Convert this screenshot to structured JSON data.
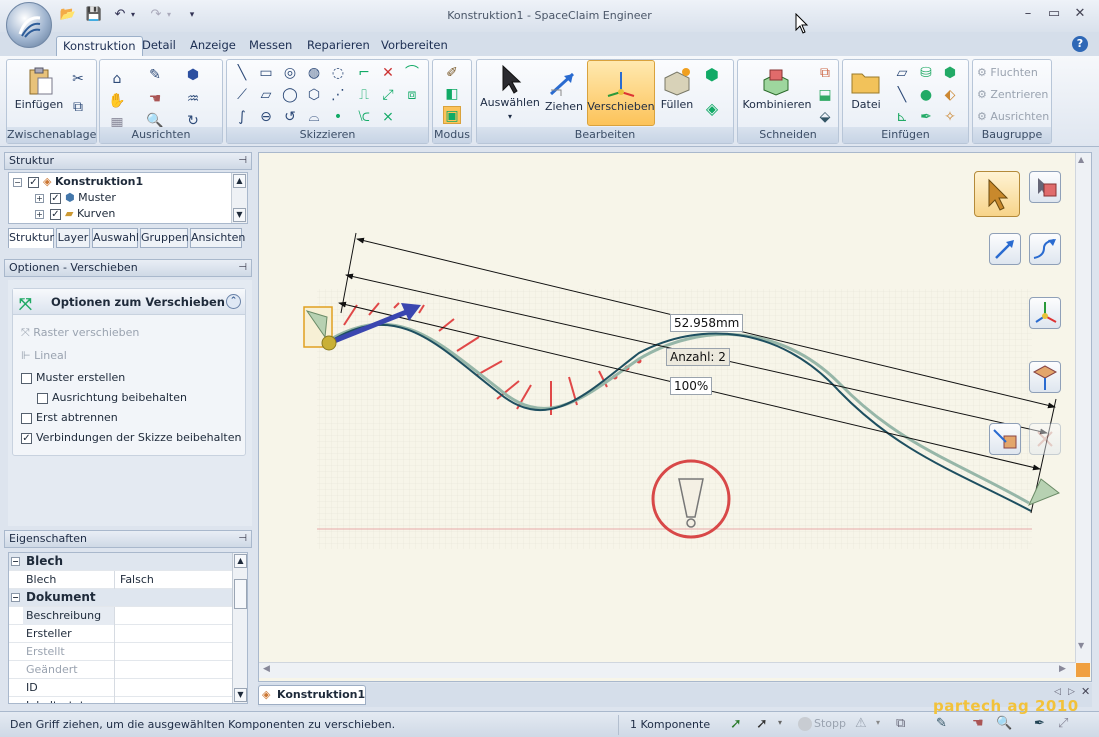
{
  "window": {
    "title": "Konstruktion1 - SpaceClaim Engineer"
  },
  "ribbon_tabs": [
    "Konstruktion",
    "Detail",
    "Anzeige",
    "Messen",
    "Reparieren",
    "Vorbereiten"
  ],
  "ribbon": {
    "groups": {
      "zwischenablage": "Zwischenablage",
      "ausrichten": "Ausrichten",
      "skizzieren": "Skizzieren",
      "modus": "Modus",
      "bearbeiten": "Bearbeiten",
      "schneiden": "Schneiden",
      "einfuegen": "Einfügen",
      "baugruppe": "Baugruppe"
    },
    "buttons": {
      "einfuegen": "Einfügen",
      "auswaehlen": "Auswählen",
      "ziehen": "Ziehen",
      "verschieben": "Verschieben",
      "fuellen": "Füllen",
      "kombinieren": "Kombinieren",
      "datei": "Datei",
      "fluchten": "Fluchten",
      "zentrieren": "Zentrieren",
      "ausrichten": "Ausrichten"
    }
  },
  "structure_panel": {
    "title": "Struktur",
    "tree": [
      {
        "label": "Konstruktion1",
        "bold": true
      },
      {
        "label": "Muster"
      },
      {
        "label": "Kurven"
      }
    ],
    "tabs": [
      "Struktur",
      "Layer",
      "Auswahl",
      "Gruppen",
      "Ansichten"
    ]
  },
  "options_panel": {
    "title": "Optionen - Verschieben",
    "section_title": "Optionen zum Verschieben",
    "items": [
      {
        "label": "Raster verschieben",
        "disabled": true
      },
      {
        "label": "Lineal",
        "disabled": true
      },
      {
        "label": "Muster erstellen",
        "checked": false
      },
      {
        "label": "Ausrichtung beibehalten",
        "checked": false
      },
      {
        "label": "Erst abtrennen",
        "checked": false
      },
      {
        "label": "Verbindungen der Skizze beibehalten",
        "checked": true
      }
    ]
  },
  "properties_panel": {
    "title": "Eigenschaften",
    "rows": [
      {
        "category": "Blech"
      },
      {
        "key": "Blech",
        "value": "Falsch"
      },
      {
        "category": "Dokument"
      },
      {
        "key": "Beschreibung",
        "value": ""
      },
      {
        "key": "Ersteller",
        "value": ""
      },
      {
        "key": "Erstellt",
        "value": "",
        "disabled": true
      },
      {
        "key": "Geändert",
        "value": "",
        "disabled": true
      },
      {
        "key": "ID",
        "value": ""
      },
      {
        "key": "Inhaltsstatus",
        "value": ""
      }
    ]
  },
  "viewport": {
    "dimension_label": "52.958mm",
    "count_label": "Anzahl: 2",
    "percent_label": "100%"
  },
  "document_tab": "Konstruktion1",
  "status": {
    "message": "Den Griff ziehen, um die ausgewählten Komponenten zu verschieben.",
    "components": "1 Komponente",
    "stop": "Stopp"
  },
  "watermark": "partech ag 2010",
  "colors": {
    "accent": "#fcc35a",
    "ribbon_bg": "#dfe6f0",
    "viewport_bg": "#f7f5e9"
  }
}
